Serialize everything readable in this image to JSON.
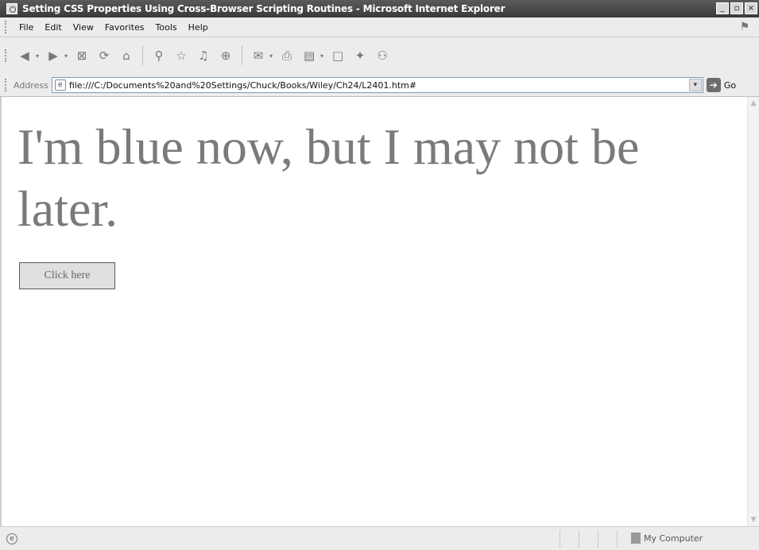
{
  "window": {
    "title": "Setting CSS Properties Using Cross-Browser Scripting Routines - Microsoft Internet Explorer",
    "controls": [
      "_",
      "▫",
      "×"
    ]
  },
  "menu": {
    "items": [
      "File",
      "Edit",
      "View",
      "Favorites",
      "Tools",
      "Help"
    ]
  },
  "toolbar": {
    "buttons": [
      {
        "name": "back-icon",
        "glyph": "◀"
      },
      {
        "name": "forward-icon",
        "glyph": "▶"
      },
      {
        "name": "stop-icon",
        "glyph": "⊠"
      },
      {
        "name": "refresh-icon",
        "glyph": "⟳"
      },
      {
        "name": "home-icon",
        "glyph": "⌂"
      },
      {
        "name": "search-icon",
        "glyph": "⚲"
      },
      {
        "name": "favorites-icon",
        "glyph": "☆"
      },
      {
        "name": "media-icon",
        "glyph": "♫"
      },
      {
        "name": "history-icon",
        "glyph": "⊕"
      },
      {
        "name": "mail-icon",
        "glyph": "✉"
      },
      {
        "name": "print-icon",
        "glyph": "⎙"
      },
      {
        "name": "edit-icon",
        "glyph": "▤"
      },
      {
        "name": "discuss-icon",
        "glyph": "□"
      },
      {
        "name": "messenger-icon",
        "glyph": "✦"
      },
      {
        "name": "research-icon",
        "glyph": "⚇"
      }
    ]
  },
  "address": {
    "label": "Address",
    "url": "file:///C:/Documents%20and%20Settings/Chuck/Books/Wiley/Ch24/L2401.htm#",
    "go_label": "Go"
  },
  "page": {
    "heading": "I'm blue now, but I may not be later.",
    "button_label": "Click here",
    "heading_color": "#7a7a7a"
  },
  "status": {
    "zone_label": "My Computer"
  }
}
